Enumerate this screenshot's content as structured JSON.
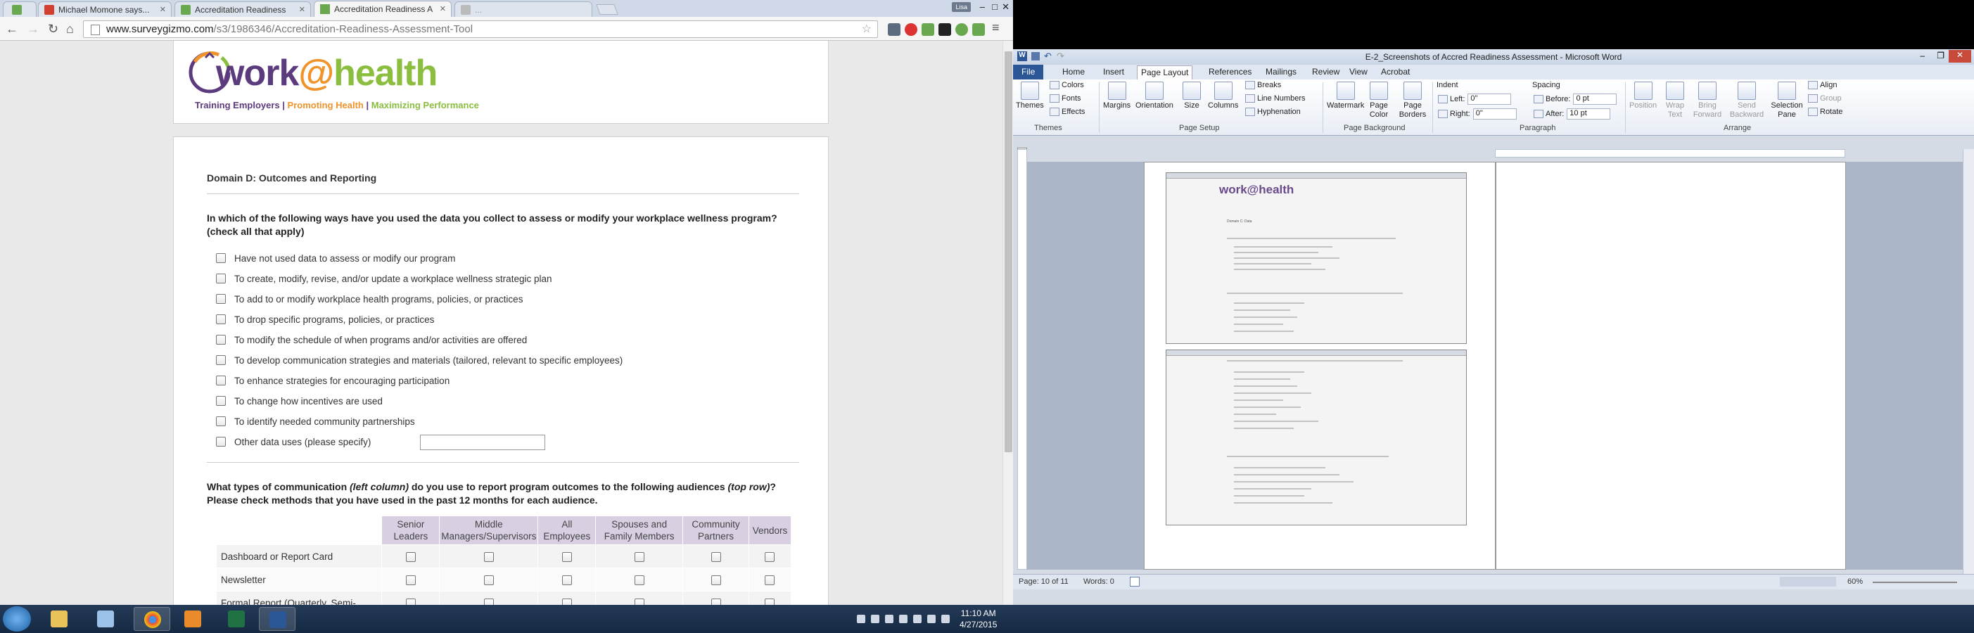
{
  "browser": {
    "tabs": [
      {
        "label": "Michael Momone says...",
        "color": "#d23f31"
      },
      {
        "label": "Accreditation Readiness",
        "color": "#6aa84f"
      },
      {
        "label": "Accreditation Readiness A",
        "color": "#6aa84f"
      },
      {
        "label": "...",
        "color": "#999999"
      }
    ],
    "profile": "Lisa",
    "url_host": "www.surveygizmo.com",
    "url_path": "/s3/1986346/Accreditation-Readiness-Assessment-Tool"
  },
  "brand": {
    "name_prefix": "work",
    "name_at": "@",
    "name_suffix": "health",
    "tag1": "Training Employers",
    "tag2": "Promoting Health",
    "tag3": "Maximizing Performance",
    "sep": " | ",
    "color_purple": "#5c3a7e",
    "color_orange": "#f0932b",
    "color_green": "#8bbd3e"
  },
  "survey": {
    "domain_title": "Domain D: Outcomes and Reporting",
    "q1": "In which of the following ways have you used the data you collect to assess or modify your workplace wellness program? (check all that apply)",
    "q1_options": [
      "Have not used data to assess or modify our program",
      "To create, modify, revise, and/or update a workplace wellness strategic plan",
      "To add to or modify workplace health programs, policies, or practices",
      "To drop specific programs, policies, or practices",
      "To modify the schedule of when programs and/or activities are offered",
      "To develop communication strategies and materials (tailored, relevant to specific employees)",
      "To enhance strategies for encouraging participation",
      "To change how incentives are used",
      "To identify needed community partnerships",
      "Other data uses (please specify)"
    ],
    "q2_a": "What types of communication ",
    "q2_b": "(left column)",
    "q2_c": " do you use to report program outcomes to the following audiences ",
    "q2_d": "(top row)",
    "q2_e": "? Please check methods that you have used in the past 12 months for each audience.",
    "columns": [
      "Senior Leaders",
      "Middle Managers/Supervisors",
      "All Employees",
      "Spouses and Family Members",
      "Community Partners",
      "Vendors"
    ],
    "rows": [
      "Dashboard or Report Card",
      "Newsletter",
      "Formal Report (Quarterly, Semi-"
    ]
  },
  "word": {
    "title": "E-2_Screenshots of Accred Readiness Assessment  -  Microsoft Word",
    "tabs": [
      "File",
      "Home",
      "Insert",
      "Page Layout",
      "References",
      "Mailings",
      "Review",
      "View",
      "Acrobat"
    ],
    "themes": {
      "themes": "Themes",
      "colors": "Colors",
      "fonts": "Fonts",
      "effects": "Effects",
      "group": "Themes"
    },
    "page_setup": {
      "margins": "Margins",
      "orientation": "Orientation",
      "size": "Size",
      "columns": "Columns",
      "breaks": "Breaks",
      "line_numbers": "Line Numbers",
      "hyphenation": "Hyphenation",
      "group": "Page Setup"
    },
    "page_bg": {
      "watermark": "Watermark",
      "page_color": "Page Color",
      "page_borders": "Page Borders",
      "group": "Page Background"
    },
    "paragraph": {
      "indent": "Indent",
      "left": "Left:",
      "right": "Right:",
      "left_val": "0\"",
      "right_val": "0\"",
      "spacing": "Spacing",
      "before": "Before:",
      "after": "After:",
      "before_val": "0 pt",
      "after_val": "10 pt",
      "group": "Paragraph"
    },
    "arrange": {
      "position": "Position",
      "wrap": "Wrap Text",
      "forward": "Bring Forward",
      "backward": "Send Backward",
      "selection": "Selection Pane",
      "align": "Align",
      "group_btn": "Group",
      "rotate": "Rotate",
      "group": "Arrange"
    },
    "status": {
      "page": "Page: 10 of 11",
      "words": "Words: 0",
      "zoom": "60%"
    },
    "mini_logo": "work@health",
    "mini_domain": "Domain C: Data"
  },
  "taskbar": {
    "time": "11:10 AM",
    "date": "4/27/2015"
  }
}
